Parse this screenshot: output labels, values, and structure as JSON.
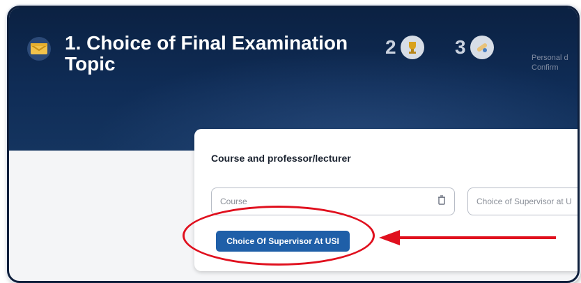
{
  "header": {
    "title": "1. Choice of Final Examination Topic",
    "steps": [
      {
        "number": "2",
        "icon": "trophy-icon"
      },
      {
        "number": "3",
        "icon": "diploma-icon"
      }
    ],
    "step4_label": "Personal d\nConfirm"
  },
  "card": {
    "title": "Course and professor/lecturer",
    "course_placeholder": "Course",
    "supervisor_placeholder": "Choice of Supervisor at U",
    "choose_button_label": "Choice Of Supervisor At USI"
  },
  "annotation": {
    "color": "#e0101e"
  },
  "colors": {
    "header_bg": "#0f2c56",
    "button_bg": "#1f5fa8"
  }
}
